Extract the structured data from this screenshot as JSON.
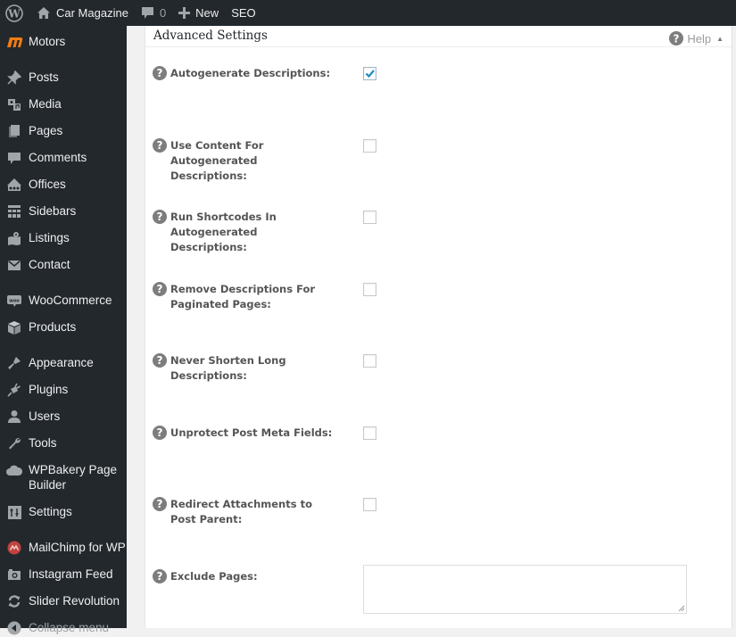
{
  "adminbar": {
    "site_name": "Car Magazine",
    "comments_count": "0",
    "new_label": "New",
    "seo_label": "SEO"
  },
  "sidebar": {
    "items": [
      {
        "label": "Motors",
        "icon": "motors-logo-icon"
      },
      {
        "label": "Posts",
        "icon": "pushpin-icon"
      },
      {
        "label": "Media",
        "icon": "media-icon"
      },
      {
        "label": "Pages",
        "icon": "pages-icon"
      },
      {
        "label": "Comments",
        "icon": "comment-bubble-icon"
      },
      {
        "label": "Offices",
        "icon": "offices-icon"
      },
      {
        "label": "Sidebars",
        "icon": "sidebars-grid-icon"
      },
      {
        "label": "Listings",
        "icon": "map-pin-icon"
      },
      {
        "label": "Contact",
        "icon": "envelope-icon"
      },
      {
        "label": "WooCommerce",
        "icon": "woocommerce-icon"
      },
      {
        "label": "Products",
        "icon": "box-icon"
      },
      {
        "label": "Appearance",
        "icon": "paintbrush-icon"
      },
      {
        "label": "Plugins",
        "icon": "plug-icon"
      },
      {
        "label": "Users",
        "icon": "user-icon"
      },
      {
        "label": "Tools",
        "icon": "wrench-icon"
      },
      {
        "label": "WPBakery Page Builder",
        "icon": "cloud-icon"
      },
      {
        "label": "Settings",
        "icon": "settings-sliders-icon"
      },
      {
        "label": "MailChimp for WP",
        "icon": "mailchimp-icon"
      },
      {
        "label": "Instagram Feed",
        "icon": "camera-icon"
      },
      {
        "label": "Slider Revolution",
        "icon": "refresh-icon"
      },
      {
        "label": "Collapse menu",
        "icon": "collapse-arrow-icon"
      }
    ]
  },
  "panel": {
    "title": "Advanced Settings",
    "help_label": "Help",
    "settings": [
      {
        "label": "Autogenerate Descriptions:",
        "checked": true
      },
      {
        "label": "Use Content For Autogenerated Descriptions:",
        "checked": false
      },
      {
        "label": "Run Shortcodes In Autogenerated Descriptions:",
        "checked": false
      },
      {
        "label": "Remove Descriptions For Paginated Pages:",
        "checked": false
      },
      {
        "label": "Never Shorten Long Descriptions:",
        "checked": false
      },
      {
        "label": "Unprotect Post Meta Fields:",
        "checked": false
      },
      {
        "label": "Redirect Attachments to Post Parent:",
        "checked": false
      }
    ],
    "exclude_pages": {
      "label": "Exclude Pages:",
      "value": ""
    }
  },
  "colors": {
    "adminbar_bg": "#23282d",
    "sidebar_bg": "#23282d",
    "checkmark": "#1e8cbe",
    "motors_orange": "#f07c14",
    "mailchimp_red": "#c1433f"
  }
}
